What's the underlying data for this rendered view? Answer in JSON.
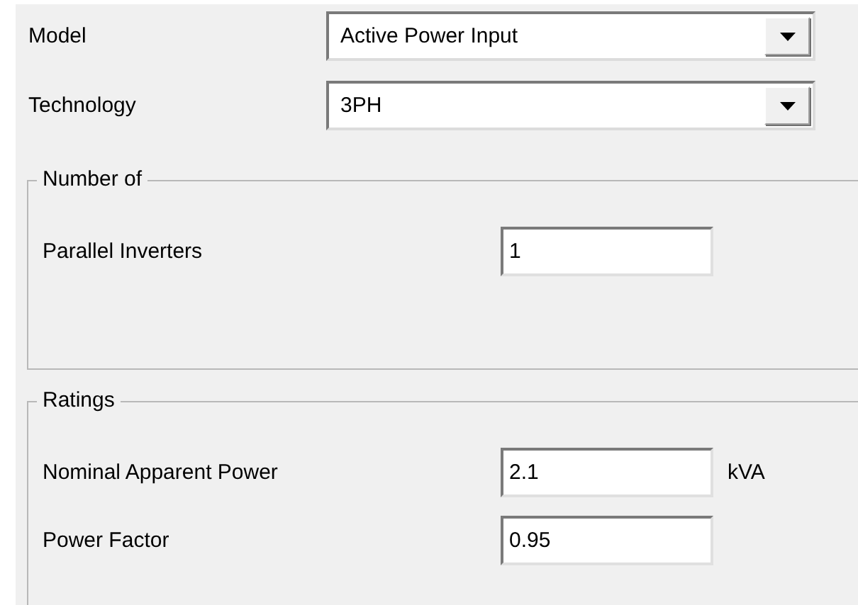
{
  "fields": [
    {
      "label": "Model",
      "value": "Active Power Input"
    },
    {
      "label": "Technology",
      "value": "3PH"
    }
  ],
  "groups": [
    {
      "title": "Number of",
      "rows": [
        {
          "label": "Parallel Inverters",
          "value": "1"
        }
      ]
    },
    {
      "title": "Ratings",
      "rows": [
        {
          "label": "Nominal Apparent Power",
          "value": "2.1",
          "unit": "kVA"
        },
        {
          "label": "Power Factor",
          "value": "0.95"
        }
      ]
    }
  ]
}
